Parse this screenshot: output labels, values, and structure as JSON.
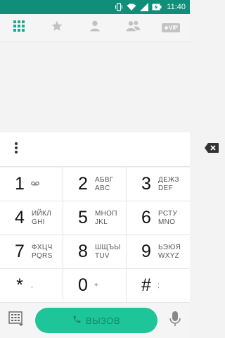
{
  "status_bar": {
    "time": "11:40",
    "icons": [
      "vibrate-icon",
      "wifi-icon",
      "signal-icon",
      "battery-charging-icon"
    ]
  },
  "tabs": [
    {
      "name": "dialpad",
      "icon": "dialpad-grid-icon",
      "active": true
    },
    {
      "name": "favorites",
      "icon": "star-icon",
      "active": false
    },
    {
      "name": "contacts",
      "icon": "person-icon",
      "active": false
    },
    {
      "name": "groups",
      "icon": "people-icon",
      "active": false
    },
    {
      "name": "vip",
      "icon": "vip-icon",
      "label": "★VIP",
      "active": false
    }
  ],
  "input": {
    "value": "",
    "menu_icon": "overflow-menu-icon",
    "backspace_icon": "backspace-icon"
  },
  "keys": [
    {
      "digit": "1",
      "letters_top": "",
      "letters_bottom": "",
      "sub": "voicemail"
    },
    {
      "digit": "2",
      "letters_top": "АБВГ",
      "letters_bottom": "ABC"
    },
    {
      "digit": "3",
      "letters_top": "ДЕЖЗ",
      "letters_bottom": "DEF"
    },
    {
      "digit": "4",
      "letters_top": "ИЙКЛ",
      "letters_bottom": "GHI"
    },
    {
      "digit": "5",
      "letters_top": "МНОП",
      "letters_bottom": "JKL"
    },
    {
      "digit": "6",
      "letters_top": "РСТУ",
      "letters_bottom": "MNO"
    },
    {
      "digit": "7",
      "letters_top": "ФХЦЧ",
      "letters_bottom": "PQRS"
    },
    {
      "digit": "8",
      "letters_top": "ШЩЪЫ",
      "letters_bottom": "TUV"
    },
    {
      "digit": "9",
      "letters_top": "ЬЭЮЯ",
      "letters_bottom": "WXYZ"
    },
    {
      "digit": "*",
      "sub": ","
    },
    {
      "digit": "0",
      "sub": "+"
    },
    {
      "digit": "#",
      "sub": ";"
    }
  ],
  "bottom": {
    "call_label": "ВЫЗОВ",
    "left_icon": "dialpad-toggle-icon",
    "right_icon": "microphone-icon"
  },
  "colors": {
    "status_bar": "#0f8f7a",
    "accent": "#1dc598",
    "tab_active": "#1aaa92",
    "tab_inactive": "#c2c2c2"
  }
}
